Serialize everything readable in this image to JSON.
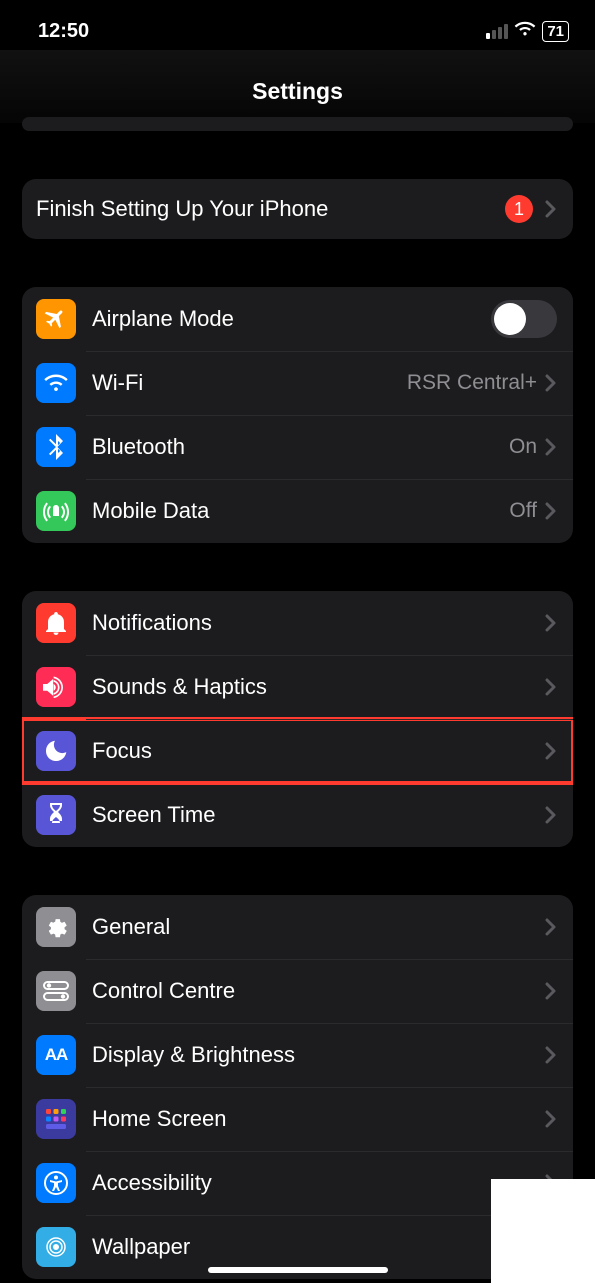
{
  "status": {
    "time": "12:50",
    "battery": "71"
  },
  "header": {
    "title": "Settings"
  },
  "finish": {
    "label": "Finish Setting Up Your iPhone",
    "badge": "1"
  },
  "connectivity": {
    "airplane": "Airplane Mode",
    "wifi": {
      "label": "Wi-Fi",
      "value": "RSR Central+"
    },
    "bluetooth": {
      "label": "Bluetooth",
      "value": "On"
    },
    "mobiledata": {
      "label": "Mobile Data",
      "value": "Off"
    }
  },
  "attention": {
    "notifications": "Notifications",
    "sounds": "Sounds & Haptics",
    "focus": "Focus",
    "screentime": "Screen Time"
  },
  "general_group": {
    "general": "General",
    "control": "Control Centre",
    "display": "Display & Brightness",
    "home": "Home Screen",
    "accessibility": "Accessibility",
    "wallpaper": "Wallpaper"
  }
}
